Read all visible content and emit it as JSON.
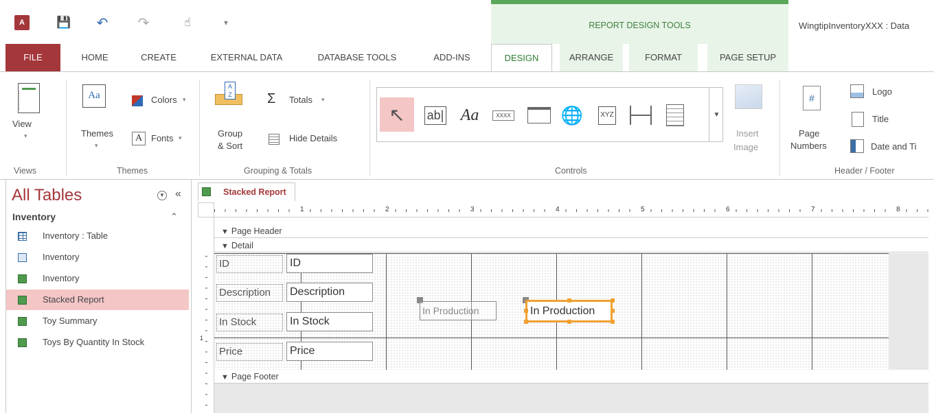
{
  "qat": {
    "app_icon": "A",
    "icons": [
      "access-logo",
      "save-icon",
      "undo-icon",
      "redo-icon",
      "touch-mode-icon",
      "customize-qat-icon"
    ]
  },
  "context": {
    "title": "REPORT DESIGN TOOLS",
    "window_title": "WingtipInventoryXXX : Data"
  },
  "tabs": {
    "file": "FILE",
    "home": "HOME",
    "create": "CREATE",
    "external": "EXTERNAL DATA",
    "dbtools": "DATABASE TOOLS",
    "addins": "ADD-INS",
    "design": "DESIGN",
    "arrange": "ARRANGE",
    "format": "FORMAT",
    "pagesetup": "PAGE SETUP"
  },
  "ribbon": {
    "views": {
      "view": "View",
      "group": "Views"
    },
    "themes": {
      "themes": "Themes",
      "colors": "Colors",
      "fonts": "Fonts",
      "group": "Themes"
    },
    "grouping": {
      "group_sort_1": "Group",
      "group_sort_2": "& Sort",
      "totals": "Totals",
      "hide_details": "Hide Details",
      "group": "Grouping & Totals"
    },
    "controls": {
      "textbox": "ab|",
      "label": "Aa",
      "button": "XXXX",
      "chart": "XYZ",
      "insert_image_1": "Insert",
      "insert_image_2": "Image",
      "group": "Controls"
    },
    "header_footer": {
      "page_numbers_1": "Page",
      "page_numbers_2": "Numbers",
      "logo": "Logo",
      "title": "Title",
      "date_time": "Date and Ti",
      "group": "Header / Footer"
    }
  },
  "nav": {
    "title": "All Tables",
    "section": "Inventory",
    "items": [
      {
        "label": "Inventory : Table",
        "type": "table"
      },
      {
        "label": "Inventory",
        "type": "form"
      },
      {
        "label": "Inventory",
        "type": "report"
      },
      {
        "label": "Stacked Report",
        "type": "report",
        "active": true
      },
      {
        "label": "Toy Summary",
        "type": "report"
      },
      {
        "label": "Toys By Quantity In Stock",
        "type": "report"
      }
    ]
  },
  "document": {
    "tab_label": "Stacked Report",
    "ruler_numbers": [
      "1",
      "2",
      "3",
      "4",
      "5",
      "6",
      "7",
      "8"
    ],
    "vruler_number": "1",
    "sections": {
      "page_header": "Page Header",
      "detail": "Detail",
      "page_footer": "Page Footer"
    },
    "fields": [
      {
        "label": "ID",
        "value": "ID"
      },
      {
        "label": "Description",
        "value": "Description"
      },
      {
        "label": "In Stock",
        "value": "In Stock"
      },
      {
        "label": "Price",
        "value": "Price"
      }
    ],
    "production_label": "In Production",
    "production_text": "In Production"
  }
}
